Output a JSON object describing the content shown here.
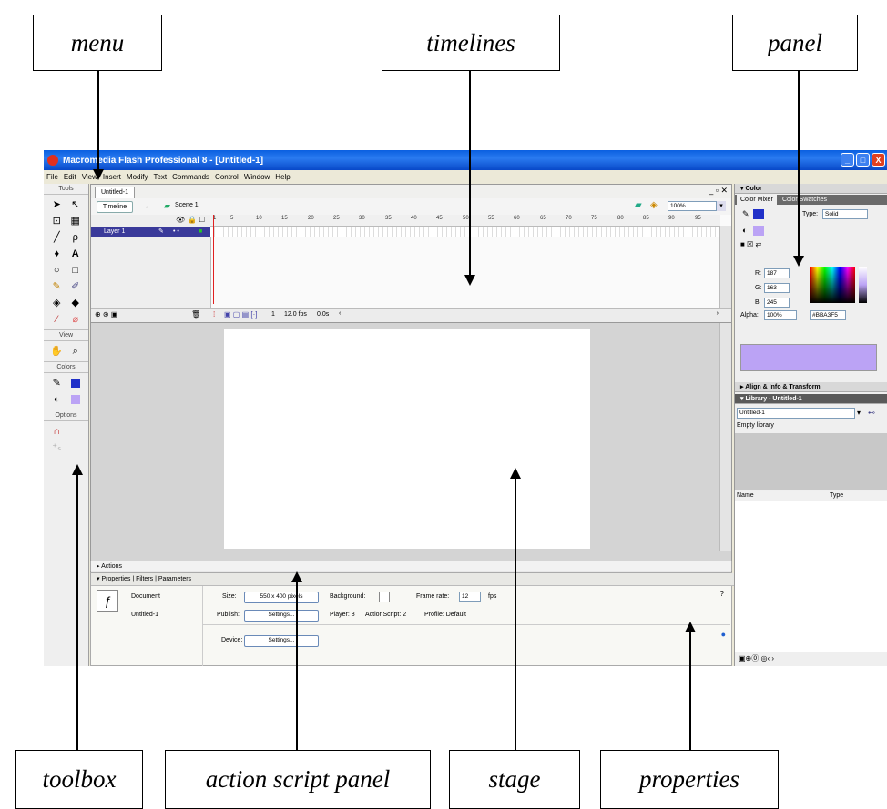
{
  "callouts": {
    "menu": "menu",
    "timelines": "timelines",
    "panel": "panel",
    "toolbox": "toolbox",
    "action_script_panel": "action script panel",
    "stage": "stage",
    "properties": "properties"
  },
  "window": {
    "title": "Macromedia Flash Professional 8 - [Untitled-1]",
    "minimize": "_",
    "maximize": "□",
    "close": "X"
  },
  "menubar": [
    "File",
    "Edit",
    "View",
    "Insert",
    "Modify",
    "Text",
    "Commands",
    "Control",
    "Window",
    "Help"
  ],
  "tools": {
    "header": "Tools",
    "view_header": "View",
    "colors_header": "Colors",
    "options_header": "Options",
    "icons": [
      "selection-icon",
      "subselection-icon",
      "free-transform-icon",
      "fill-transform-icon",
      "line-icon",
      "lasso-icon",
      "pen-icon",
      "text-icon",
      "oval-icon",
      "rectangle-icon",
      "pencil-icon",
      "brush-icon",
      "ink-bottle-icon",
      "paint-bucket-icon",
      "eyedropper-icon",
      "eraser-icon"
    ]
  },
  "document": {
    "tab": "Untitled-1",
    "timeline_button": "Timeline",
    "scene": "Scene 1",
    "zoom": "100%",
    "layer_name": "Layer 1",
    "ruler": [
      "1",
      "5",
      "10",
      "15",
      "20",
      "25",
      "30",
      "35",
      "40",
      "45",
      "50",
      "55",
      "60",
      "65",
      "70",
      "75",
      "80",
      "85",
      "90",
      "95"
    ],
    "frame": "1",
    "fps": "12.0 fps",
    "time": "0.0s"
  },
  "actions": {
    "label": "Actions"
  },
  "properties": {
    "tabs": [
      "Properties",
      "Filters",
      "Parameters"
    ],
    "doc_label": "Document",
    "doc_name": "Untitled-1",
    "size_label": "Size:",
    "size_value": "550 x 400 pixels",
    "background_label": "Background:",
    "framerate_label": "Frame rate:",
    "framerate_value": "12",
    "fps_unit": "fps",
    "publish_label": "Publish:",
    "settings_button": "Settings...",
    "player": "Player: 8",
    "actionscript": "ActionScript: 2",
    "profile": "Profile: Default",
    "device_label": "Device:",
    "device_button": "Settings..."
  },
  "color_panel": {
    "header": "Color",
    "tabs": [
      "Color Mixer",
      "Color Swatches"
    ],
    "type_label": "Type:",
    "type_value": "Solid",
    "r_label": "R:",
    "r_value": "187",
    "g_label": "G:",
    "g_value": "163",
    "b_label": "B:",
    "b_value": "245",
    "alpha_label": "Alpha:",
    "alpha_value": "100%",
    "hex_value": "#BBA3F5",
    "fill_color": "#bba3f5",
    "stroke_color": "#2030c8"
  },
  "align_panel": {
    "header": "Align & Info & Transform"
  },
  "library_panel": {
    "header": "Library - Untitled-1",
    "select_value": "Untitled-1",
    "empty": "Empty library",
    "col_name": "Name",
    "col_type": "Type"
  }
}
